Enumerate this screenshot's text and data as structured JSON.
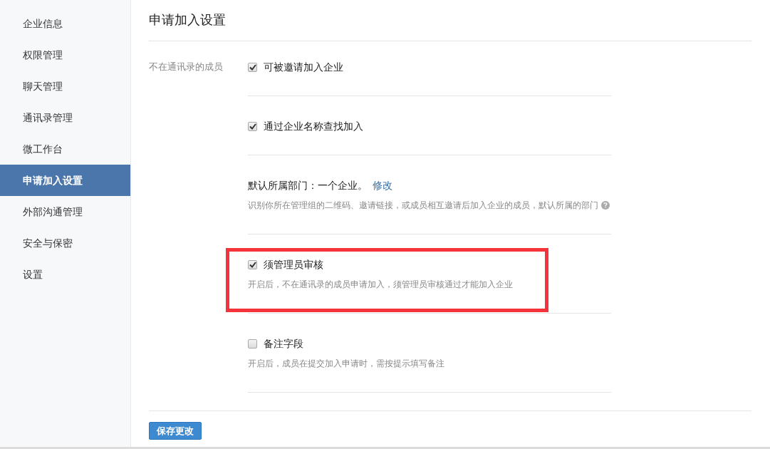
{
  "sidebar": {
    "items": [
      {
        "label": "企业信息",
        "selected": false
      },
      {
        "label": "权限管理",
        "selected": false
      },
      {
        "label": "聊天管理",
        "selected": false
      },
      {
        "label": "通讯录管理",
        "selected": false
      },
      {
        "label": "微工作台",
        "selected": false
      },
      {
        "label": "申请加入设置",
        "selected": true
      },
      {
        "label": "外部沟通管理",
        "selected": false
      },
      {
        "label": "安全与保密",
        "selected": false
      },
      {
        "label": "设置",
        "selected": false
      }
    ]
  },
  "page_title": "申请加入设置",
  "group_label": "不在通讯录的成员",
  "options": [
    {
      "kind": "checkbox",
      "label": "可被邀请加入企业",
      "checked": true,
      "highlighted": false
    },
    {
      "kind": "checkbox",
      "label": "通过企业名称查找加入",
      "checked": true,
      "highlighted": false
    },
    {
      "kind": "department",
      "label": "默认所属部门：一个企业。",
      "link": "修改",
      "description": "识别你所在管理组的二维码、邀请链接，或成员相互邀请后加入企业的成员，默认所属的部门",
      "highlighted": false
    },
    {
      "kind": "checkbox",
      "label": "须管理员审核",
      "checked": true,
      "description": "开启后，不在通讯录的成员申请加入，须管理员审核通过才能加入企业",
      "highlighted": true
    },
    {
      "kind": "checkbox",
      "label": "备注字段",
      "checked": false,
      "description": "开启后，成员在提交加入申请时，需按提示填写备注",
      "highlighted": false
    }
  ],
  "save_button": "保存更改"
}
